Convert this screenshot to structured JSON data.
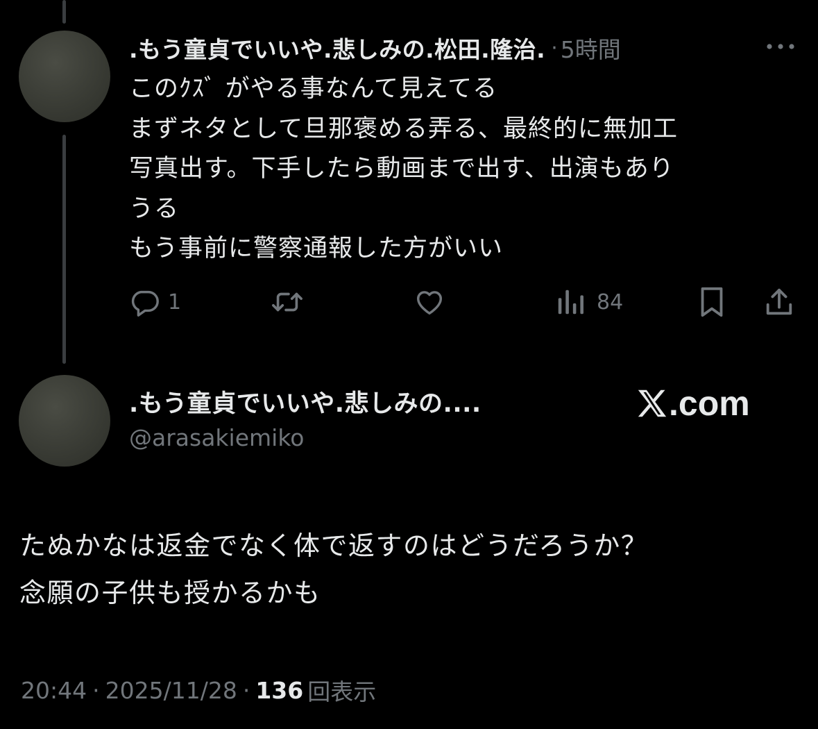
{
  "reply": {
    "display_name": ".もう童貞でいいや.悲しみの.松田.隆治.",
    "separator": "·",
    "time_ago": "5時間",
    "more_icon": "more-dots-icon",
    "lines": [
      "このｸｽﾞ がやる事なんて見えてる",
      "まずネタとして旦那褒める弄る、最終的に無加工",
      "写真出す。下手したら動画まで出す、出演もあり",
      "うる",
      "もう事前に警察通報した方がいい"
    ],
    "actions": {
      "reply_icon": "reply-bubble-icon",
      "reply_count": "1",
      "repost_icon": "repost-icon",
      "like_icon": "heart-icon",
      "views_icon": "views-bars-icon",
      "views_count": "84",
      "bookmark_icon": "bookmark-icon",
      "share_icon": "share-icon"
    }
  },
  "card": {
    "display_name": ".もう童貞でいいや.悲しみの....",
    "handle": "@arasakiemiko",
    "logo_text": ".com",
    "logo_icon": "x-logo-icon"
  },
  "main_post": {
    "lines": [
      "たぬかなは返金でなく体で返すのはどうだろうか？",
      "念願の子供も授かるかも"
    ],
    "time": "20:44",
    "sep1": "·",
    "date": "2025/11/28",
    "sep2": "·",
    "views_count": "136",
    "views_label": "回表示"
  },
  "colors": {
    "background": "#000000",
    "text_primary": "#e7e9ea",
    "text_secondary": "#71767b",
    "thread_line": "#3a3d40"
  }
}
